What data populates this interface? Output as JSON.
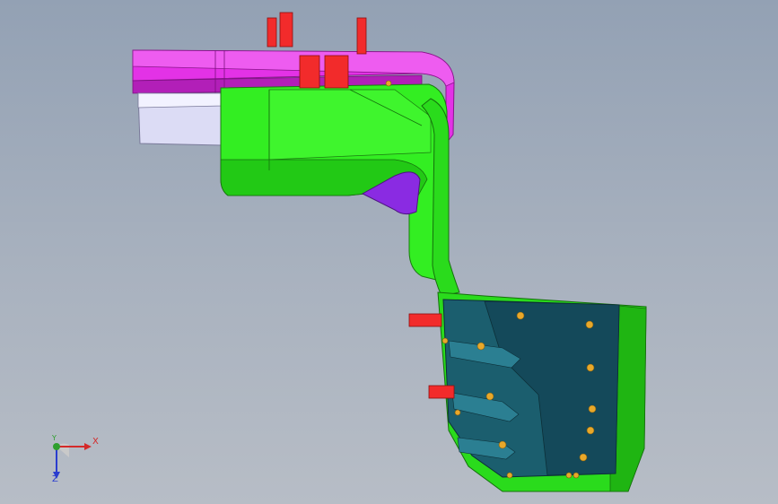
{
  "viewport": {
    "background_top": "#93a1b4",
    "background_bottom": "#b7bdc6"
  },
  "model": {
    "colors": {
      "magenta_plate": "#e332e6",
      "magenta_dark": "#b21fb8",
      "green_body": "#33ee22",
      "green_dark": "#1fb512",
      "lavender_block": "#dcdcf5",
      "purple_cavity": "#8a2be2",
      "teal_insert": "#1b5e6e",
      "teal_dark": "#123f4c",
      "red_pin": "#f22b2b",
      "gold_screw": "#e8a82a"
    }
  },
  "triad": {
    "x_label": "X",
    "y_label": "Y",
    "z_label": "Z",
    "x_color": "#d42a2a",
    "y_color": "#2e9f2e",
    "z_color": "#2a3dcf"
  }
}
